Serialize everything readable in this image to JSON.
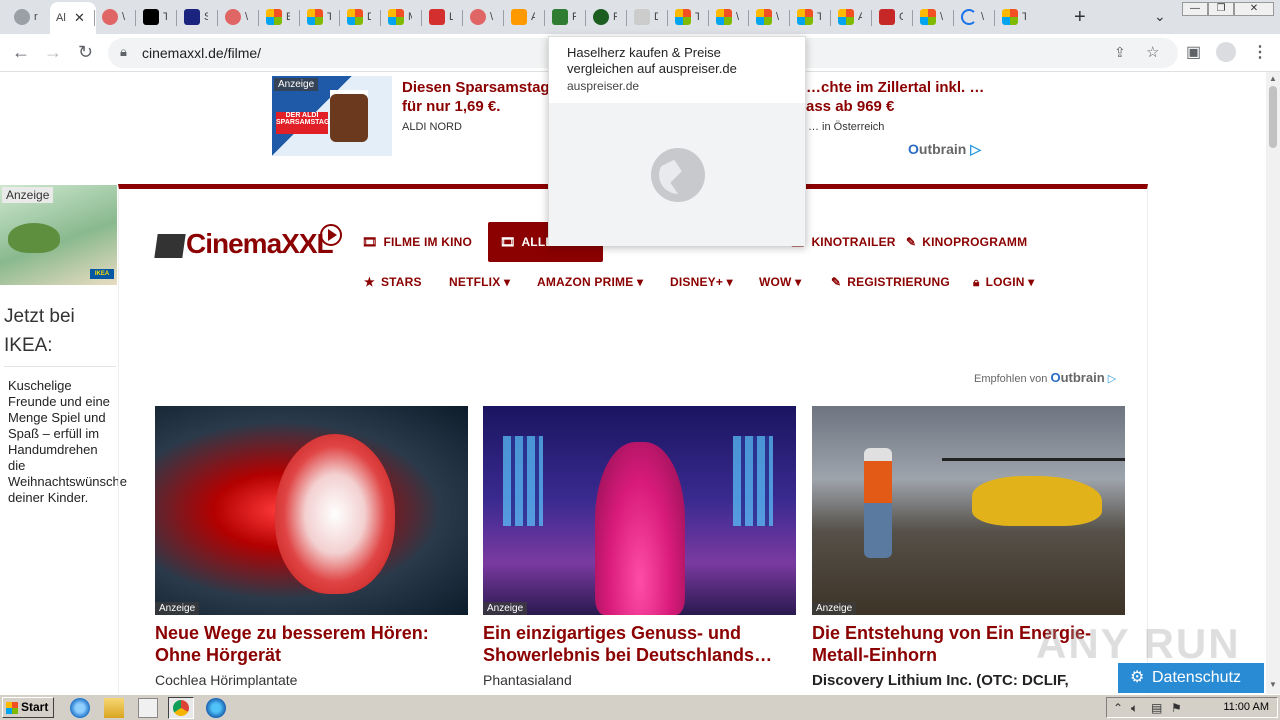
{
  "browser": {
    "active_tab_title": "Al",
    "first_tab_title": "r",
    "url": "cinemaxxl.de/filme/",
    "new_tab_symbol": "+",
    "tab_list_symbol": "⌄",
    "window_controls": [
      "—",
      "❐",
      "✕"
    ]
  },
  "tabs": [
    {
      "icon": "chrome-icon",
      "color": "#9aa0a6",
      "label": "r"
    },
    {
      "icon": "anyrun-icon",
      "color": "#e06666",
      "label": "\\"
    },
    {
      "icon": "appletv-icon",
      "color": "#000000",
      "label": "T"
    },
    {
      "icon": "mb-icon",
      "color": "#1a237e",
      "label": "S"
    },
    {
      "icon": "anyrun-icon",
      "color": "#e06666",
      "label": "\\"
    },
    {
      "icon": "microsoft-icon",
      "color": "ms",
      "label": "E"
    },
    {
      "icon": "microsoft-icon",
      "color": "ms",
      "label": "T"
    },
    {
      "icon": "microsoft-icon",
      "color": "ms",
      "label": "D"
    },
    {
      "icon": "microsoft-icon",
      "color": "ms",
      "label": "M"
    },
    {
      "icon": "red-arc-icon",
      "color": "#d32f2f",
      "label": "L"
    },
    {
      "icon": "anyrun-icon",
      "color": "#e06666",
      "label": "\\"
    },
    {
      "icon": "amazon-icon",
      "color": "#ff9900",
      "label": "A"
    },
    {
      "icon": "tag-icon",
      "color": "#2e7d32",
      "label": "F"
    },
    {
      "icon": "circle-logo-icon",
      "color": "#1b5e20",
      "label": "F"
    },
    {
      "icon": "cecil-icon",
      "color": "#cccccc",
      "label": "D"
    },
    {
      "icon": "microsoft-icon",
      "color": "ms",
      "label": "T"
    },
    {
      "icon": "microsoft-icon",
      "color": "ms",
      "label": "\\"
    },
    {
      "icon": "microsoft-icon",
      "color": "ms",
      "label": "\\"
    },
    {
      "icon": "microsoft-icon",
      "color": "ms",
      "label": "T"
    },
    {
      "icon": "microsoft-icon",
      "color": "ms",
      "label": "A"
    },
    {
      "icon": "pen-icon",
      "color": "#c62828",
      "label": "C"
    },
    {
      "icon": "microsoft-icon",
      "color": "ms",
      "label": "\\"
    },
    {
      "icon": "loading-icon",
      "color": "#1a73e8",
      "label": "\\"
    },
    {
      "icon": "microsoft-icon",
      "color": "ms",
      "label": "T"
    }
  ],
  "top_ad": {
    "badge": "Anzeige",
    "ad1_title": "Diesen Sparsamstag für nur 1,69 €.",
    "ad1_source": "ALDI NORD",
    "ad1_image_text": "DER ALDI SPARSAMSTAG",
    "ad2_title": "…chte im Zillertal inkl. …ass ab 969 €",
    "ad2_source": "… in Österreich",
    "outbrain": "utbrain"
  },
  "popup": {
    "title": "Haselherz kaufen & Preise vergleichen auf auspreiser.de",
    "domain": "auspreiser.de"
  },
  "left_ad": {
    "badge": "Anzeige",
    "brand": "IKEA",
    "heading": "Jetzt bei IKEA:",
    "text": "Kuschelige Freunde und eine Menge Spiel und Spaß – erfüll im Handumdrehen die Weihnachtswünsche deiner Kinder."
  },
  "site": {
    "logo": "CinemaXXL",
    "nav_row1": [
      {
        "icon": "film-icon",
        "label": "FILME IM KINO"
      },
      {
        "icon": "film-icon",
        "label": "ALLE…"
      },
      {
        "icon": "film-icon",
        "label": "KINOTRAILER"
      },
      {
        "icon": "ticket-icon",
        "label": "KINOPROGRAMM"
      }
    ],
    "nav_row2": [
      {
        "icon": "star-icon",
        "label": "STARS"
      },
      {
        "icon": "",
        "label": "NETFLIX"
      },
      {
        "icon": "",
        "label": "AMAZON PRIME"
      },
      {
        "icon": "",
        "label": "DISNEY+"
      },
      {
        "icon": "",
        "label": "WOW"
      },
      {
        "icon": "pencil-icon",
        "label": "REGISTRIERUNG"
      },
      {
        "icon": "lock-icon",
        "label": "LOGIN"
      }
    ],
    "dropdown_caret": "▾",
    "empfohlen": "Empfohlen von",
    "outbrain": "utbrain"
  },
  "cards": [
    {
      "badge": "Anzeige",
      "title": "Neue Wege zu besserem Hören: Ohne Hörgerät",
      "source": "Cochlea Hörimplantate"
    },
    {
      "badge": "Anzeige",
      "title": "Ein einzigartiges Genuss- und Showerlebnis bei Deutschlands…",
      "source": "Phantasialand"
    },
    {
      "badge": "Anzeige",
      "title": "Die Entstehung von Ein Energie-Metall-Einhorn",
      "source": "Discovery Lithium Inc. (OTC: DCLIF,"
    }
  ],
  "datenschutz": "Datenschutz",
  "watermark": "ANY RUN",
  "taskbar": {
    "start": "Start",
    "clock": "11:00 AM"
  }
}
